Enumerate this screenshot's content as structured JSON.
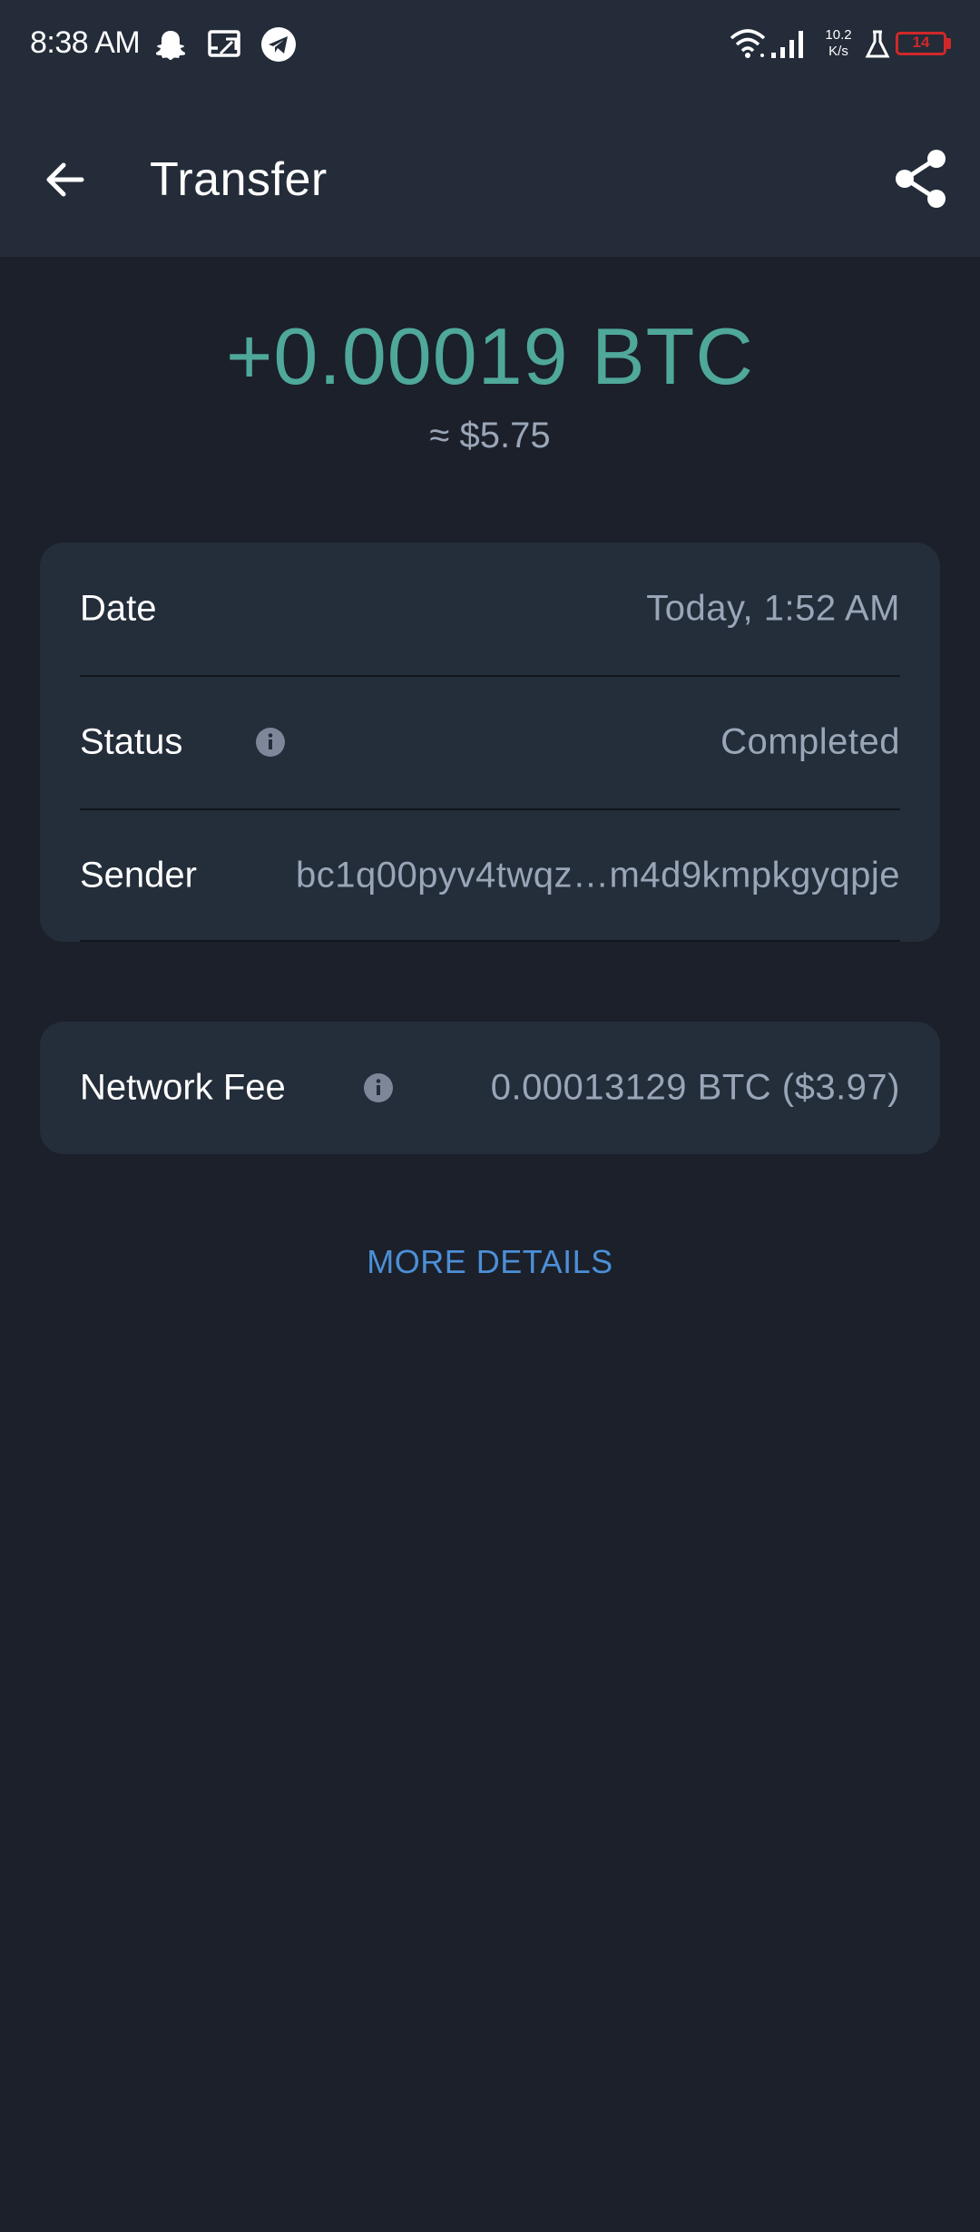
{
  "status_bar": {
    "time": "8:38 AM",
    "icons": [
      "snapchat-icon",
      "cast-icon",
      "telegram-icon",
      "wifi-icon",
      "signal-icon",
      "flask-icon"
    ],
    "net_speed_value": "10.2",
    "net_speed_unit": "K/s",
    "battery_level": "14",
    "battery_color": "#d0282a"
  },
  "app_bar": {
    "title": "Transfer"
  },
  "transaction": {
    "amount": "+0.00019 BTC",
    "fiat_equivalent": "≈ $5.75",
    "amount_color": "#4fa89a"
  },
  "details": {
    "date_label": "Date",
    "date_value": "Today, 1:52 AM",
    "status_label": "Status",
    "status_value": "Completed",
    "sender_label": "Sender",
    "sender_value": "bc1q00pyv4twqz…m4d9kmpkgyqpje"
  },
  "fee": {
    "label": "Network Fee",
    "value": "0.00013129 BTC ($3.97)"
  },
  "more_details": {
    "label": "MORE DETAILS",
    "color": "#4c8fd6"
  }
}
